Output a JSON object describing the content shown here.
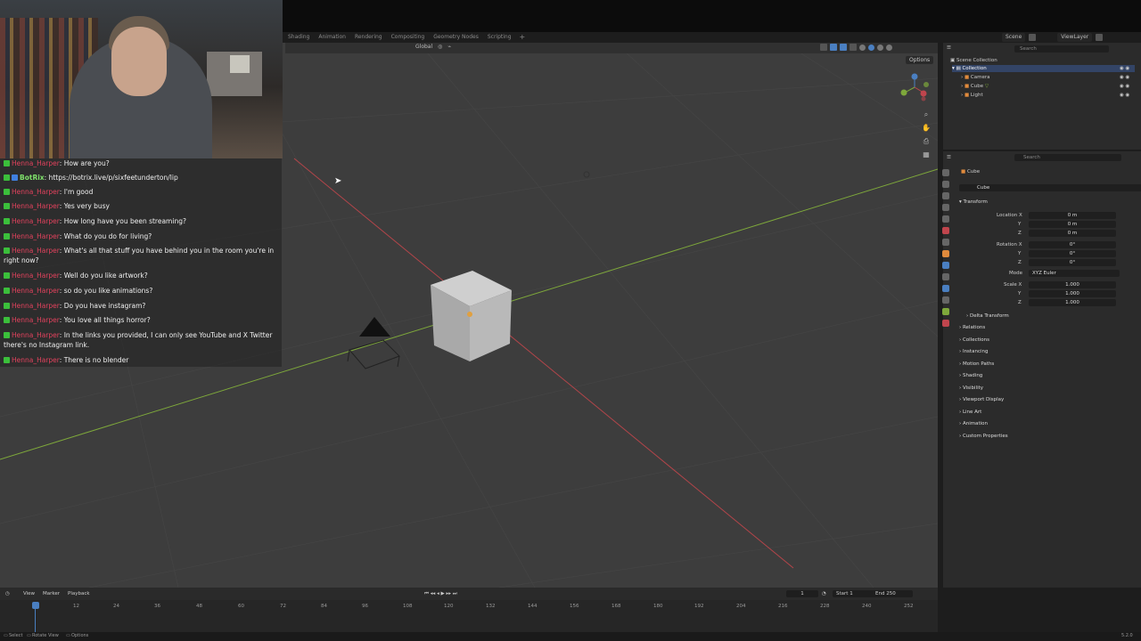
{
  "workspace_tabs": [
    "Shading",
    "Animation",
    "Rendering",
    "Compositing",
    "Geometry Nodes",
    "Scripting"
  ],
  "scene_name": "Scene",
  "view_layer": "ViewLayer",
  "viewport": {
    "orientation": "Global",
    "options_label": "Options",
    "grid_color": "#3d3d3d",
    "x_axis_color": "#b3454a",
    "y_axis_color": "#7ea83b"
  },
  "chat": [
    {
      "user": "Henna_Harper",
      "msg": "How are you?"
    },
    {
      "user": "BotRix",
      "msg": "https://botrix.live/p/sixfeetunderton/lip",
      "bot": true
    },
    {
      "user": "Henna_Harper",
      "msg": "I'm good"
    },
    {
      "user": "Henna_Harper",
      "msg": "Yes very busy"
    },
    {
      "user": "Henna_Harper",
      "msg": "How long have you been streaming?"
    },
    {
      "user": "Henna_Harper",
      "msg": "What do you do for living?"
    },
    {
      "user": "Henna_Harper",
      "msg": "What's all that stuff you have behind you in the room you're in right now?"
    },
    {
      "user": "Henna_Harper",
      "msg": "Well do you like artwork?"
    },
    {
      "user": "Henna_Harper",
      "msg": "so do you like animations?"
    },
    {
      "user": "Henna_Harper",
      "msg": "Do you have instagram?"
    },
    {
      "user": "Henna_Harper",
      "msg": "You love all things horror?"
    },
    {
      "user": "Henna_Harper",
      "msg": "In the links you provided, I can only see YouTube and X Twitter there's no Instagram link."
    },
    {
      "user": "Henna_Harper",
      "msg": "There is no blender"
    }
  ],
  "outliner": {
    "search_placeholder": "Search",
    "root": "Scene Collection",
    "collection": "Collection",
    "items": [
      "Camera",
      "Cube",
      "Light"
    ]
  },
  "properties": {
    "search_placeholder": "Search",
    "object_name": "Cube",
    "object_data_name": "Cube",
    "transform_label": "Transform",
    "location_label": "Location X",
    "location": [
      "0 m",
      "0 m",
      "0 m"
    ],
    "rotation_label": "Rotation X",
    "rotation": [
      "0°",
      "0°",
      "0°"
    ],
    "mode_label": "Mode",
    "mode_value": "XYZ Euler",
    "scale_label": "Scale X",
    "scale": [
      "1.000",
      "1.000",
      "1.000"
    ],
    "axis_y": "Y",
    "axis_z": "Z",
    "delta_transform": "Delta Transform",
    "sections": [
      "Relations",
      "Collections",
      "Instancing",
      "Motion Paths",
      "Shading",
      "Visibility",
      "Viewport Display",
      "Line Art",
      "Animation",
      "Custom Properties"
    ]
  },
  "timeline": {
    "menus": [
      "View",
      "Marker",
      "Playback"
    ],
    "current_frame": "1",
    "start_label": "Start",
    "start": "1",
    "end_label": "End",
    "end": "250",
    "ticks": [
      "1",
      "12",
      "24",
      "36",
      "48",
      "60",
      "72",
      "84",
      "96",
      "108",
      "120",
      "132",
      "144",
      "156",
      "168",
      "180",
      "192",
      "204",
      "216",
      "228",
      "240",
      "252"
    ]
  },
  "statusbar": {
    "select": "Select",
    "rotate": "Rotate View",
    "options": "Options",
    "version": "5.2.0"
  }
}
